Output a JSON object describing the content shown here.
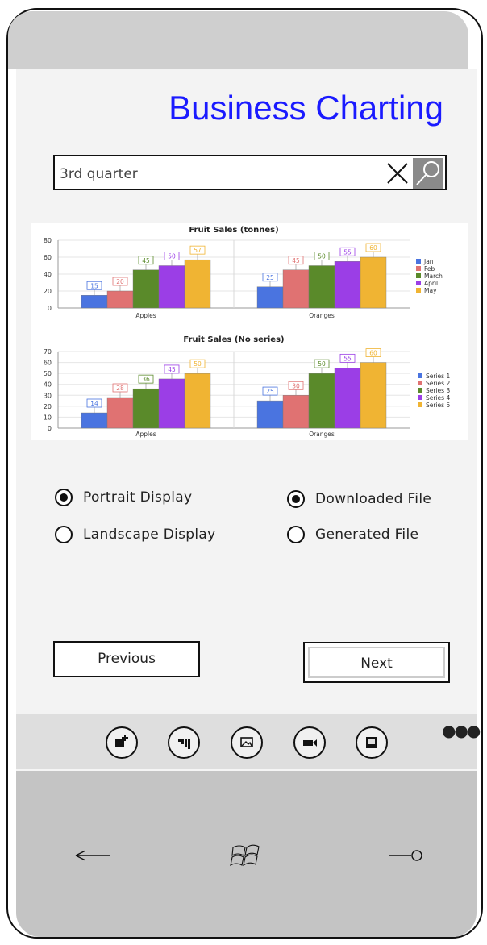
{
  "app": {
    "title": "Business Charting"
  },
  "search": {
    "value": "3rd quarter"
  },
  "icons": {
    "clear": "close-icon",
    "search": "search-icon",
    "appbar": [
      "add-icon",
      "signal-icon",
      "image-icon",
      "video-icon",
      "save-icon"
    ],
    "more": "more-icon",
    "back": "back-arrow-icon",
    "start": "windows-logo-icon",
    "search_hw": "search-key-icon"
  },
  "chart_data": [
    {
      "type": "bar",
      "title": "Fruit Sales (tonnes)",
      "categories": [
        "Apples",
        "Oranges"
      ],
      "ylim": [
        0,
        80
      ],
      "yticks": [
        0,
        20,
        40,
        60,
        80
      ],
      "series": [
        {
          "name": "Jan",
          "color": "#4a74e0",
          "values": [
            15,
            25
          ]
        },
        {
          "name": "Feb",
          "color": "#e07272",
          "values": [
            20,
            45
          ]
        },
        {
          "name": "March",
          "color": "#5a8a2a",
          "values": [
            45,
            50
          ]
        },
        {
          "name": "April",
          "color": "#9b3ee6",
          "values": [
            50,
            55
          ]
        },
        {
          "name": "May",
          "color": "#f0b433",
          "values": [
            57,
            60
          ]
        }
      ]
    },
    {
      "type": "bar",
      "title": "Fruit Sales (No series)",
      "categories": [
        "Apples",
        "Oranges"
      ],
      "ylim": [
        0,
        70
      ],
      "yticks": [
        0,
        10,
        20,
        30,
        40,
        50,
        60,
        70
      ],
      "series": [
        {
          "name": "Series 1",
          "color": "#4a74e0",
          "values": [
            14,
            25
          ]
        },
        {
          "name": "Series 2",
          "color": "#e07272",
          "values": [
            28,
            30
          ]
        },
        {
          "name": "Series 3",
          "color": "#5a8a2a",
          "values": [
            36,
            50
          ]
        },
        {
          "name": "Series 4",
          "color": "#9b3ee6",
          "values": [
            45,
            55
          ]
        },
        {
          "name": "Series 5",
          "color": "#f0b433",
          "values": [
            50,
            60
          ]
        }
      ]
    }
  ],
  "options": {
    "orientation": [
      {
        "label": "Portrait Display",
        "selected": true
      },
      {
        "label": "Landscape Display",
        "selected": false
      }
    ],
    "source": [
      {
        "label": "Downloaded File",
        "selected": true
      },
      {
        "label": "Generated File",
        "selected": false
      }
    ]
  },
  "nav": {
    "previous": "Previous",
    "next": "Next"
  }
}
